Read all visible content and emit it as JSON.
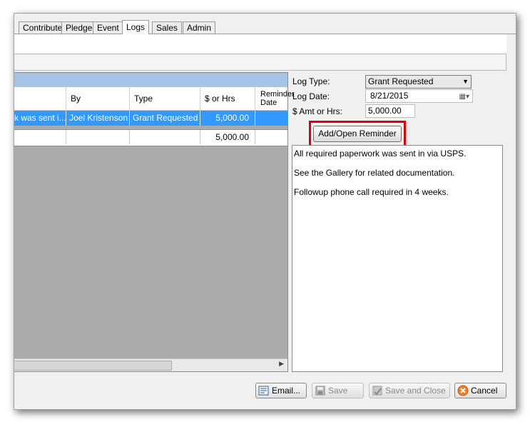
{
  "tabs": [
    "Contribute",
    "Pledge",
    "Event",
    "Logs",
    "Sales",
    "Admin"
  ],
  "active_tab": "Logs",
  "grid": {
    "columns": [
      "By",
      "Type",
      "$ or Hrs",
      "Reminder Date"
    ],
    "row": {
      "description": "k was sent i...",
      "by": "Joel Kristenson",
      "type": "Grant Requested",
      "amount": "5,000.00"
    },
    "total": "5,000.00"
  },
  "form": {
    "log_type_label": "Log Type:",
    "log_type_value": "Grant Requested",
    "log_date_label": "Log Date:",
    "log_date_value": "8/21/2015",
    "amount_label": "$ Amt or Hrs:",
    "amount_value": "5,000.00",
    "reminder_button": "Add/Open Reminder",
    "notes": [
      "All required paperwork was sent in via USPS.",
      "See the Gallery for related documentation.",
      "Followup phone call required in 4 weeks."
    ]
  },
  "buttons": {
    "email": "Email...",
    "save": "Save",
    "save_close": "Save and Close",
    "cancel": "Cancel"
  },
  "colors": {
    "selected_row": "#3399ff",
    "grid_band": "#a7c3e4",
    "highlight_box": "#e00000",
    "grid_bg": "#ababab"
  }
}
